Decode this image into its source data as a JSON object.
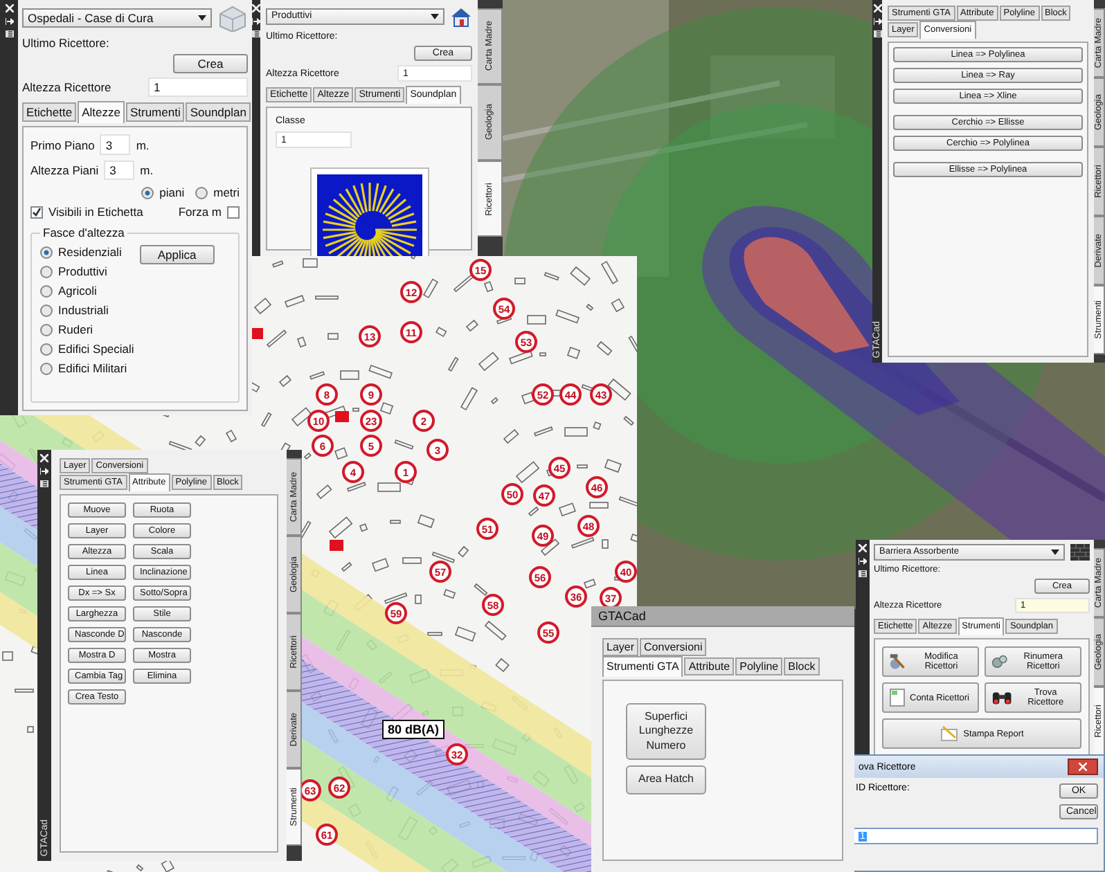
{
  "panel_altezze": {
    "dropdown": "Ospedali - Case di Cura",
    "last_label": "Ultimo Ricettore:",
    "create_button": "Crea",
    "height_label": "Altezza Ricettore",
    "height_value": "1",
    "tabs": [
      {
        "label": "Etichette",
        "selected": false
      },
      {
        "label": "Altezze",
        "selected": true
      },
      {
        "label": "Strumenti",
        "selected": false
      },
      {
        "label": "Soundplan",
        "selected": false
      }
    ],
    "first_floor_label": "Primo Piano",
    "first_floor_value": "3",
    "first_floor_unit": "m.",
    "floor_height_label": "Altezza Piani",
    "floor_height_value": "3",
    "floor_height_unit": "m.",
    "unit_options": [
      {
        "label": "piani",
        "selected": true
      },
      {
        "label": "metri",
        "selected": false
      }
    ],
    "visible_in_label": {
      "label": "Visibili in Etichetta",
      "checked": true
    },
    "force_m": {
      "label": "Forza m",
      "checked": false
    },
    "group_title": "Fasce d'altezza",
    "apply_button": "Applica",
    "classes": [
      {
        "label": "Residenziali",
        "selected": true
      },
      {
        "label": "Produttivi",
        "selected": false
      },
      {
        "label": "Agricoli",
        "selected": false
      },
      {
        "label": "Industriali",
        "selected": false
      },
      {
        "label": "Ruderi",
        "selected": false
      },
      {
        "label": "Edifici Speciali",
        "selected": false
      },
      {
        "label": "Edifici Militari",
        "selected": false
      }
    ]
  },
  "panel_soundplan": {
    "dropdown": "Produttivi",
    "last_label": "Ultimo Ricettore:",
    "create_button": "Crea",
    "height_label": "Altezza Ricettore",
    "height_value": "1",
    "tabs": [
      {
        "label": "Etichette",
        "selected": false
      },
      {
        "label": "Altezze",
        "selected": false
      },
      {
        "label": "Strumenti",
        "selected": false
      },
      {
        "label": "Soundplan",
        "selected": true
      }
    ],
    "class_label": "Classe",
    "class_value": "1",
    "side_tabs": [
      {
        "label": "Carta Madre",
        "selected": false
      },
      {
        "label": "Geologia",
        "selected": false
      },
      {
        "label": "Ricettori",
        "selected": true
      }
    ]
  },
  "map": {
    "receptors": [
      "15",
      "12",
      "54",
      "13",
      "11",
      "53",
      "8",
      "9",
      "52",
      "44",
      "43",
      "10",
      "23",
      "2",
      "6",
      "5",
      "3",
      "4",
      "1",
      "45",
      "50",
      "47",
      "46",
      "51",
      "49",
      "48",
      "57",
      "56",
      "40",
      "59",
      "58",
      "36",
      "37",
      "55",
      "32",
      "63",
      "62",
      "61"
    ],
    "noise_label": "80 dB(A)"
  },
  "panel_conversioni": {
    "strip_label": "GTACad",
    "tab_rows": [
      [
        {
          "label": "Strumenti GTA",
          "selected": false
        },
        {
          "label": "Attribute",
          "selected": false
        },
        {
          "label": "Polyline",
          "selected": false
        },
        {
          "label": "Block",
          "selected": false
        }
      ],
      [
        {
          "label": "Layer",
          "selected": false
        },
        {
          "label": "Conversioni",
          "selected": true
        }
      ]
    ],
    "button_groups": [
      [
        "Linea => Polylinea",
        "Linea => Ray",
        "Linea => Xline"
      ],
      [
        "Cerchio => Ellisse",
        "Cerchio => Polylinea"
      ],
      [
        "Ellisse => Polylinea"
      ]
    ],
    "side_tabs": [
      {
        "label": "Carta Madre",
        "selected": false
      },
      {
        "label": "Geologia",
        "selected": false
      },
      {
        "label": "Ricettori",
        "selected": false
      },
      {
        "label": "Derivate",
        "selected": false
      },
      {
        "label": "Strumenti",
        "selected": true
      }
    ]
  },
  "panel_attribute": {
    "strip_label": "GTACad",
    "tab_rows": [
      [
        {
          "label": "Layer",
          "selected": false
        },
        {
          "label": "Conversioni",
          "selected": false
        }
      ],
      [
        {
          "label": "Strumenti GTA",
          "selected": false
        },
        {
          "label": "Attribute",
          "selected": true
        },
        {
          "label": "Polyline",
          "selected": false
        },
        {
          "label": "Block",
          "selected": false
        }
      ]
    ],
    "buttons": [
      "Muove",
      "Ruota",
      "Layer",
      "Colore",
      "Altezza",
      "Scala",
      "Linea",
      "Inclinazione",
      "Dx => Sx",
      "Sotto/Sopra",
      "Larghezza",
      "Stile",
      "Nasconde D",
      "Nasconde",
      "Mostra D",
      "Mostra",
      "Cambia Tag",
      "Elimina",
      "Crea Testo"
    ],
    "side_tabs": [
      {
        "label": "Carta Madre",
        "selected": false
      },
      {
        "label": "Geologia",
        "selected": false
      },
      {
        "label": "Ricettori",
        "selected": false
      },
      {
        "label": "Derivate",
        "selected": false
      },
      {
        "label": "Strumenti",
        "selected": true
      }
    ]
  },
  "gtacad_window": {
    "title": "GTACad",
    "tab_rows": [
      [
        {
          "label": "Layer",
          "selected": false
        },
        {
          "label": "Conversioni",
          "selected": false
        }
      ],
      [
        {
          "label": "Strumenti GTA",
          "selected": true
        },
        {
          "label": "Attribute",
          "selected": false
        },
        {
          "label": "Polyline",
          "selected": false
        },
        {
          "label": "Block",
          "selected": false
        }
      ]
    ],
    "buttons": [
      "Superfici Lunghezze Numero",
      "Area Hatch"
    ]
  },
  "panel_strumenti": {
    "dropdown": "Barriera Assorbente",
    "last_label": "Ultimo Ricettore:",
    "create_button": "Crea",
    "height_label": "Altezza Ricettore",
    "height_value": "1",
    "tabs": [
      {
        "label": "Etichette",
        "selected": false
      },
      {
        "label": "Altezze",
        "selected": false
      },
      {
        "label": "Strumenti",
        "selected": true
      },
      {
        "label": "Soundplan",
        "selected": false
      }
    ],
    "tools": [
      {
        "kind": "edit",
        "label": "Modifica Ricettori"
      },
      {
        "kind": "renumber",
        "label": "Rinumera Ricettori"
      },
      {
        "kind": "count",
        "label": "Conta Ricettori"
      },
      {
        "kind": "find",
        "label": "Trova Ricettore"
      }
    ],
    "report_button": "Stampa Report",
    "side_tabs": [
      {
        "label": "Carta Madre",
        "selected": false
      },
      {
        "label": "Geologia",
        "selected": false
      },
      {
        "label": "Ricettori",
        "selected": true
      }
    ]
  },
  "dialog": {
    "title": "ova Ricettore",
    "field_label": "ID Ricettore:",
    "ok_button": "OK",
    "cancel_button": "Cancel",
    "value": "1"
  }
}
